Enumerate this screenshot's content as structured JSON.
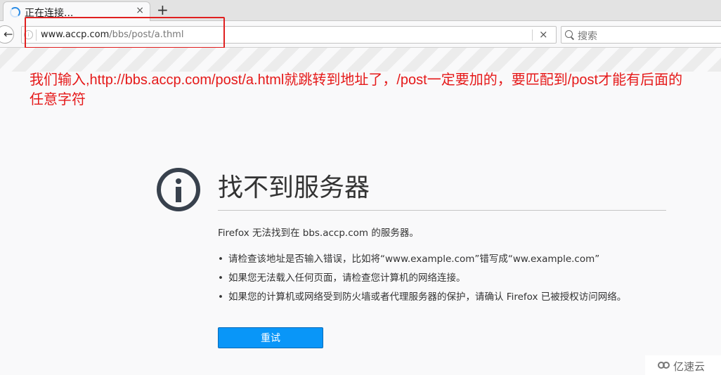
{
  "tab": {
    "title": "正在连接...",
    "close": "×",
    "new_tab": "+"
  },
  "nav": {
    "back_icon": "←",
    "url_host": "www.accp.com",
    "url_path": "/bbs/post/a.thml",
    "url_clear": "×",
    "search_placeholder": "搜索"
  },
  "annotation": {
    "text": "我们输入,http://bbs.accp.com/post/a.html就跳转到地址了，/post一定要加的，要匹配到/post才能有后面的任意字符",
    "color": "#e51919"
  },
  "error": {
    "title": "找不到服务器",
    "description": "Firefox 无法找到在 bbs.accp.com 的服务器。",
    "bullets": [
      "请检查该地址是否输入错误，比如将“www.example.com”错写成“ww.example.com”",
      "如果您无法载入任何页面，请检查您计算机的网络连接。",
      "如果您的计算机或网络受到防火墙或者代理服务器的保护，请确认 Firefox 已被授权访问网络。"
    ],
    "retry_label": "重试"
  },
  "watermark": {
    "text": "亿速云"
  },
  "colors": {
    "accent": "#0996f8",
    "icon": "#38414d"
  }
}
